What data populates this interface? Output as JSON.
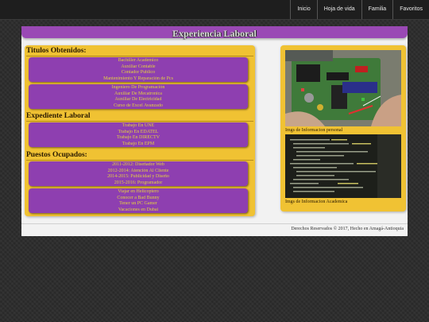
{
  "nav": {
    "items": [
      "Inicio",
      "Hoja de vida",
      "Familia",
      "Favoritos"
    ]
  },
  "header": {
    "title": "Experiencia Laboral"
  },
  "titulos": {
    "heading": "Titulos Obtenidos:",
    "group1": [
      "Bachiller Academico",
      "Auxiliar Contable",
      "Contador Publico",
      "Mantenimiento Y Reparación de Pcs"
    ],
    "group2": [
      "Ingeniero De Programación",
      "Auxiliar De Mecatronica",
      "Auxiliar De Electricidad",
      "Curso de Excel Avanzado"
    ]
  },
  "expediente": {
    "heading": "Expediente Laboral",
    "items": [
      "Trabajo En UNE",
      "Trabajo En EDATEL",
      "Trabajo En DIRECTV",
      "Trabajo En EPM"
    ]
  },
  "puestos": {
    "heading": "Puestos Ocupados:",
    "group1": [
      "2011-2012: Diseñador Web",
      "2012-2014: Atención Al Cliente",
      "2014-2015: Publicidad y Diseño",
      "2015-2016: Programador"
    ],
    "group2": [
      "Viajar en Helicoptero",
      "Conocer a Bad Bunny",
      "Tener un PC Gamer",
      "Vacaciones en Dubai"
    ]
  },
  "side": {
    "caption1": "Imgs de Informacion personal",
    "caption2": "Imgs de Informacion Academica",
    "photo1_icon": "circuit-board-image",
    "photo2_icon": "code-screen-image"
  },
  "footer": {
    "text": "Derechos Reservados © 2017, Hecho en Amagá-Antioquia"
  },
  "colors": {
    "purple": "#8e3fb0",
    "gold": "#f0c233",
    "text_yellow": "#e2d240"
  }
}
